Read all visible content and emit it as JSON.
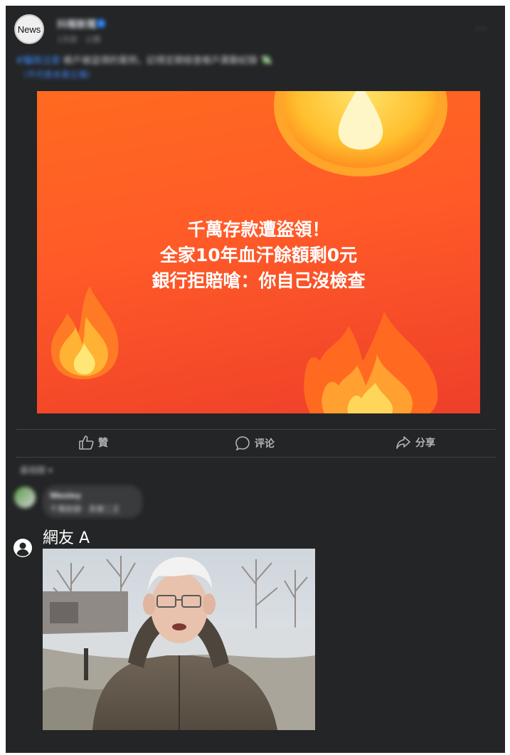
{
  "post": {
    "avatar_text": "News",
    "page_name": "抖報新聞",
    "meta": "1天前 · 公開",
    "more": "···",
    "caption_link": "#騙局注意",
    "caption_text": " 帳戶被盜領的案例，記得定期檢查帳戶異動紀錄 💸",
    "caption_line2": "（不代表本頁立場）"
  },
  "ad": {
    "line1": "千萬存款遭盜領！",
    "line2": "全家10年血汗餘額剩0元",
    "line3": "銀行拒賠嗆：你自己沒檢查",
    "colors": {
      "bg_top": "#ff6a1f",
      "bg_bottom": "#ee3f2a",
      "flame_outer": "#ffb02e",
      "flame_inner": "#ffe16a"
    }
  },
  "actions": {
    "like": "贊",
    "comment": "评论",
    "share": "分享"
  },
  "comments": {
    "sort_label": "最相關 ▾",
    "first": {
      "name": "Wesley",
      "text": "千萬餘額 · 真實二王"
    },
    "second": {
      "name": "網友 A",
      "image_alt": "meme photo"
    }
  }
}
